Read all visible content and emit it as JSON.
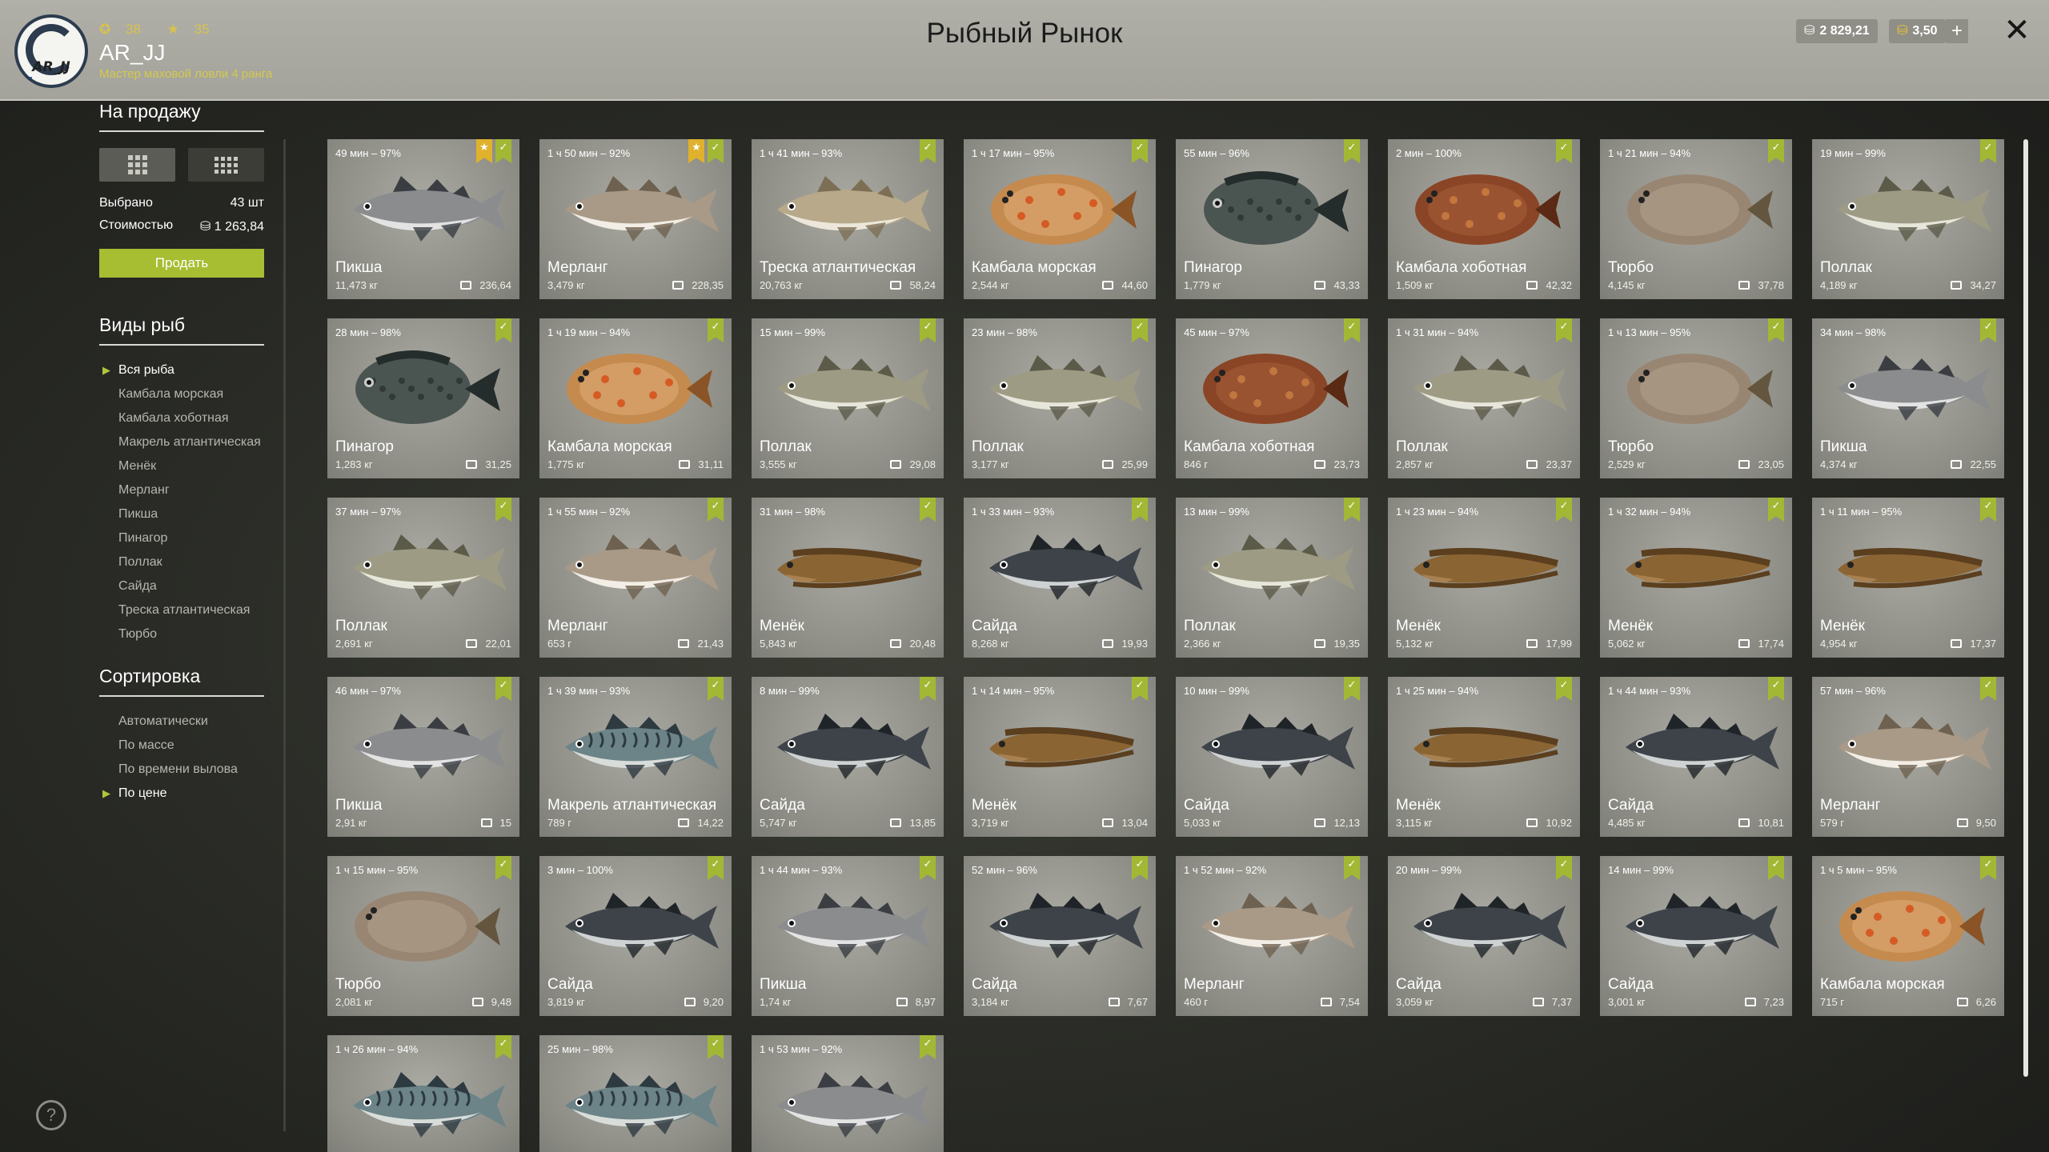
{
  "header": {
    "rank_level": "38",
    "rank_stars": "35",
    "player_name": "AR_JJ",
    "player_title": "Мастер маховой ловли 4 ранга",
    "logo_text": "AR_JJ",
    "title": "Рыбный Рынок",
    "silver_balance": "2 829,21",
    "gold_balance": "3,50",
    "plus_label": "+",
    "close_label": "✕"
  },
  "sidebar": {
    "sale_heading": "На продажу",
    "selected_label": "Выбрано",
    "selected_value": "43 шт",
    "cost_label": "Стоимостью",
    "cost_value": "1 263,84",
    "sell_label": "Продать",
    "species_heading": "Виды рыб",
    "species": [
      "Вся рыба",
      "Камбала морская",
      "Камбала хоботная",
      "Макрель атлантическая",
      "Менёк",
      "Мерланг",
      "Пикша",
      "Пинагор",
      "Поллак",
      "Сайда",
      "Треска атлантическая",
      "Тюрбо"
    ],
    "species_selected": "Вся рыба",
    "sort_heading": "Сортировка",
    "sort_options": [
      "Автоматически",
      "По массе",
      "По времени вылова",
      "По цене"
    ],
    "sort_selected": "По цене"
  },
  "help_label": "?",
  "colors": {
    "accent_green": "#a7bd32",
    "badge_gold": "#e0b12c",
    "header_bg": "#a9a9a1",
    "card_bg": "#9a9a93"
  },
  "fish_types": {
    "haddock": {
      "body": "#8a8c8e",
      "belly": "#e3e3e3",
      "dark": "#3a3d42",
      "shape": "cod"
    },
    "whiting": {
      "body": "#a99a87",
      "belly": "#f2eee6",
      "dark": "#6e6150",
      "shape": "cod"
    },
    "cod": {
      "body": "#b7a98a",
      "belly": "#ece7da",
      "dark": "#7d6f55",
      "shape": "cod"
    },
    "plaice": {
      "body": "#c48a4e",
      "belly": "#e2b07b",
      "dark": "#8a5426",
      "shape": "flat",
      "spots": "#d65a24"
    },
    "lumpsucker": {
      "body": "#4a5552",
      "belly": "#66706c",
      "dark": "#252d2c",
      "shape": "lump"
    },
    "flounder": {
      "body": "#8a4526",
      "belly": "#a9623a",
      "dark": "#5a2a14",
      "shape": "flat",
      "spots": "#c2773f"
    },
    "turbot": {
      "body": "#988672",
      "belly": "#b3a38f",
      "dark": "#64553f",
      "shape": "flat"
    },
    "pollack": {
      "body": "#9e9b85",
      "belly": "#e7e6da",
      "dark": "#5c5a48",
      "shape": "cod"
    },
    "menek": {
      "body": "#8b6433",
      "belly": "#a98150",
      "dark": "#5b3f1e",
      "shape": "eel"
    },
    "saithe": {
      "body": "#3d4349",
      "belly": "#cfd2d2",
      "dark": "#1f2428",
      "shape": "cod"
    },
    "mackerel": {
      "body": "#6c8488",
      "belly": "#d9ddd9",
      "dark": "#2d3a40",
      "shape": "mack"
    }
  },
  "fish": [
    {
      "time": "49 мин – 97%",
      "name": "Пикша",
      "weight": "11,473 кг",
      "price": "236,64",
      "type": "haddock",
      "gold": true
    },
    {
      "time": "1 ч 50 мин – 92%",
      "name": "Мерланг",
      "weight": "3,479 кг",
      "price": "228,35",
      "type": "whiting",
      "gold": true
    },
    {
      "time": "1 ч 41 мин – 93%",
      "name": "Треска атлантическая",
      "weight": "20,763 кг",
      "price": "58,24",
      "type": "cod"
    },
    {
      "time": "1 ч 17 мин – 95%",
      "name": "Камбала морская",
      "weight": "2,544 кг",
      "price": "44,60",
      "type": "plaice"
    },
    {
      "time": "55 мин – 96%",
      "name": "Пинагор",
      "weight": "1,779 кг",
      "price": "43,33",
      "type": "lumpsucker"
    },
    {
      "time": "2 мин – 100%",
      "name": "Камбала хоботная",
      "weight": "1,509 кг",
      "price": "42,32",
      "type": "flounder"
    },
    {
      "time": "1 ч 21 мин – 94%",
      "name": "Тюрбо",
      "weight": "4,145 кг",
      "price": "37,78",
      "type": "turbot"
    },
    {
      "time": "19 мин – 99%",
      "name": "Поллак",
      "weight": "4,189 кг",
      "price": "34,27",
      "type": "pollack"
    },
    {
      "time": "28 мин – 98%",
      "name": "Пинагор",
      "weight": "1,283 кг",
      "price": "31,25",
      "type": "lumpsucker"
    },
    {
      "time": "1 ч 19 мин – 94%",
      "name": "Камбала морская",
      "weight": "1,775 кг",
      "price": "31,11",
      "type": "plaice"
    },
    {
      "time": "15 мин – 99%",
      "name": "Поллак",
      "weight": "3,555 кг",
      "price": "29,08",
      "type": "pollack"
    },
    {
      "time": "23 мин – 98%",
      "name": "Поллак",
      "weight": "3,177 кг",
      "price": "25,99",
      "type": "pollack"
    },
    {
      "time": "45 мин – 97%",
      "name": "Камбала хоботная",
      "weight": "846 г",
      "price": "23,73",
      "type": "flounder"
    },
    {
      "time": "1 ч 31 мин – 94%",
      "name": "Поллак",
      "weight": "2,857 кг",
      "price": "23,37",
      "type": "pollack"
    },
    {
      "time": "1 ч 13 мин – 95%",
      "name": "Тюрбо",
      "weight": "2,529 кг",
      "price": "23,05",
      "type": "turbot"
    },
    {
      "time": "34 мин – 98%",
      "name": "Пикша",
      "weight": "4,374 кг",
      "price": "22,55",
      "type": "haddock"
    },
    {
      "time": "37 мин – 97%",
      "name": "Поллак",
      "weight": "2,691 кг",
      "price": "22,01",
      "type": "pollack"
    },
    {
      "time": "1 ч 55 мин – 92%",
      "name": "Мерланг",
      "weight": "653 г",
      "price": "21,43",
      "type": "whiting"
    },
    {
      "time": "31 мин – 98%",
      "name": "Менёк",
      "weight": "5,843 кг",
      "price": "20,48",
      "type": "menek"
    },
    {
      "time": "1 ч 33 мин – 93%",
      "name": "Сайда",
      "weight": "8,268 кг",
      "price": "19,93",
      "type": "saithe"
    },
    {
      "time": "13 мин – 99%",
      "name": "Поллак",
      "weight": "2,366 кг",
      "price": "19,35",
      "type": "pollack"
    },
    {
      "time": "1 ч 23 мин – 94%",
      "name": "Менёк",
      "weight": "5,132 кг",
      "price": "17,99",
      "type": "menek"
    },
    {
      "time": "1 ч 32 мин – 94%",
      "name": "Менёк",
      "weight": "5,062 кг",
      "price": "17,74",
      "type": "menek"
    },
    {
      "time": "1 ч 11 мин – 95%",
      "name": "Менёк",
      "weight": "4,954 кг",
      "price": "17,37",
      "type": "menek"
    },
    {
      "time": "46 мин – 97%",
      "name": "Пикша",
      "weight": "2,91 кг",
      "price": "15",
      "type": "haddock"
    },
    {
      "time": "1 ч 39 мин – 93%",
      "name": "Макрель атлантическая",
      "weight": "789 г",
      "price": "14,22",
      "type": "mackerel"
    },
    {
      "time": "8 мин – 99%",
      "name": "Сайда",
      "weight": "5,747 кг",
      "price": "13,85",
      "type": "saithe"
    },
    {
      "time": "1 ч 14 мин – 95%",
      "name": "Менёк",
      "weight": "3,719 кг",
      "price": "13,04",
      "type": "menek"
    },
    {
      "time": "10 мин – 99%",
      "name": "Сайда",
      "weight": "5,033 кг",
      "price": "12,13",
      "type": "saithe"
    },
    {
      "time": "1 ч 25 мин – 94%",
      "name": "Менёк",
      "weight": "3,115 кг",
      "price": "10,92",
      "type": "menek"
    },
    {
      "time": "1 ч 44 мин – 93%",
      "name": "Сайда",
      "weight": "4,485 кг",
      "price": "10,81",
      "type": "saithe"
    },
    {
      "time": "57 мин – 96%",
      "name": "Мерланг",
      "weight": "579 г",
      "price": "9,50",
      "type": "whiting"
    },
    {
      "time": "1 ч 15 мин – 95%",
      "name": "Тюрбо",
      "weight": "2,081 кг",
      "price": "9,48",
      "type": "turbot"
    },
    {
      "time": "3 мин – 100%",
      "name": "Сайда",
      "weight": "3,819 кг",
      "price": "9,20",
      "type": "saithe"
    },
    {
      "time": "1 ч 44 мин – 93%",
      "name": "Пикша",
      "weight": "1,74 кг",
      "price": "8,97",
      "type": "haddock"
    },
    {
      "time": "52 мин – 96%",
      "name": "Сайда",
      "weight": "3,184 кг",
      "price": "7,67",
      "type": "saithe"
    },
    {
      "time": "1 ч 52 мин – 92%",
      "name": "Мерланг",
      "weight": "460 г",
      "price": "7,54",
      "type": "whiting"
    },
    {
      "time": "20 мин – 99%",
      "name": "Сайда",
      "weight": "3,059 кг",
      "price": "7,37",
      "type": "saithe"
    },
    {
      "time": "14 мин – 99%",
      "name": "Сайда",
      "weight": "3,001 кг",
      "price": "7,23",
      "type": "saithe"
    },
    {
      "time": "1 ч 5 мин – 95%",
      "name": "Камбала морская",
      "weight": "715 г",
      "price": "6,26",
      "type": "plaice"
    },
    {
      "time": "1 ч 26 мин – 94%",
      "name": "",
      "weight": "",
      "price": "",
      "type": "mackerel"
    },
    {
      "time": "25 мин – 98%",
      "name": "",
      "weight": "",
      "price": "",
      "type": "mackerel"
    },
    {
      "time": "1 ч 53 мин – 92%",
      "name": "",
      "weight": "",
      "price": "",
      "type": "haddock"
    }
  ]
}
